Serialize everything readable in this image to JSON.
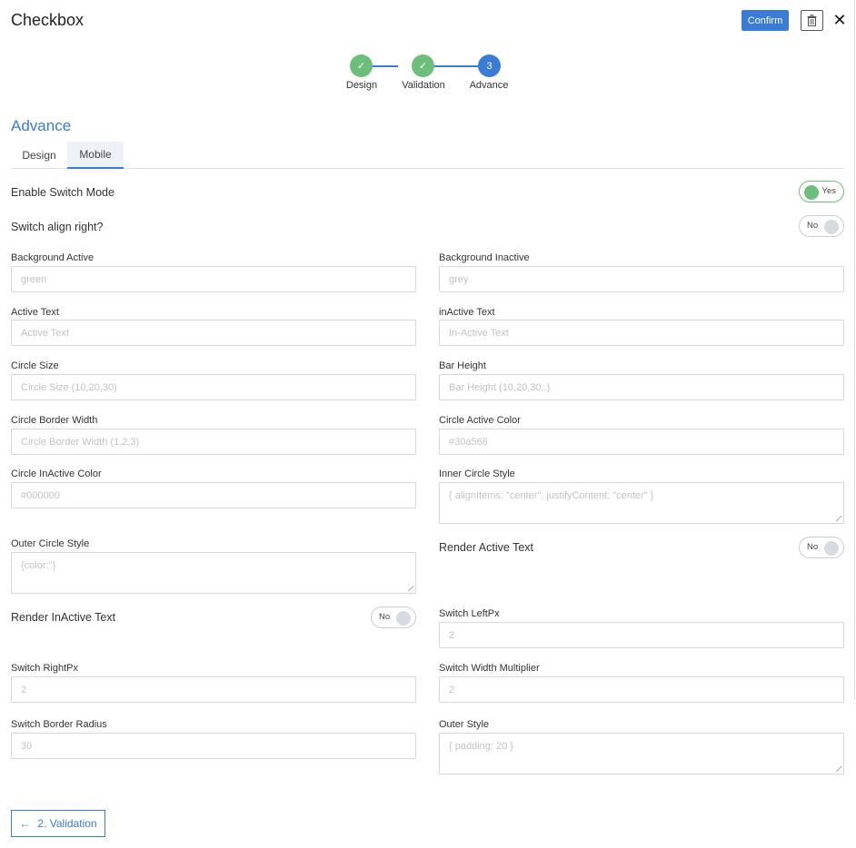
{
  "header": {
    "title": "Checkbox",
    "confirm_label": "Confirm",
    "trash_icon": "trash-icon",
    "close_glyph": "✕"
  },
  "stepper": {
    "steps": [
      {
        "label": "Design",
        "glyph": "✓",
        "state": "done"
      },
      {
        "label": "Validation",
        "glyph": "✓",
        "state": "done"
      },
      {
        "label": "Advance",
        "glyph": "3",
        "state": "active"
      }
    ]
  },
  "section": {
    "title": "Advance"
  },
  "tabs": [
    {
      "label": "Design",
      "active": false
    },
    {
      "label": "Mobile",
      "active": true
    }
  ],
  "switches": {
    "enable_switch_mode": {
      "label": "Enable Switch Mode",
      "value": "Yes"
    },
    "switch_align_right": {
      "label": "Switch align right?",
      "value": "No"
    },
    "render_active_text": {
      "label": "Render Active Text",
      "value": "No"
    },
    "render_inactive_text": {
      "label": "Render InActive Text",
      "value": "No"
    }
  },
  "fields": {
    "background_active": {
      "label": "Background Active",
      "placeholder": "green"
    },
    "background_inactive": {
      "label": "Background Inactive",
      "placeholder": "grey"
    },
    "active_text": {
      "label": "Active Text",
      "placeholder": "Active Text"
    },
    "inactive_text": {
      "label": "inActive Text",
      "placeholder": "In-Active Text"
    },
    "circle_size": {
      "label": "Circle Size",
      "placeholder": "Circle Size (10,20,30)"
    },
    "bar_height": {
      "label": "Bar Height",
      "placeholder": "Bar Height (10,20,30..)"
    },
    "circle_border_width": {
      "label": "Circle Border Width",
      "placeholder": "Circle Border Width (1,2,3)"
    },
    "circle_active_color": {
      "label": "Circle Active Color",
      "placeholder": "#30a566"
    },
    "circle_inactive_color": {
      "label": "Circle InActive Color",
      "placeholder": "#000000"
    },
    "inner_circle_style": {
      "label": "Inner Circle Style",
      "placeholder": "{ alignItems: \"center\", justifyContent: \"center\" }"
    },
    "outer_circle_style": {
      "label": "Outer Circle Style",
      "placeholder": "{color:''}"
    },
    "switch_left_px": {
      "label": "Switch LeftPx",
      "placeholder": "2"
    },
    "switch_right_px": {
      "label": "Switch RightPx",
      "placeholder": "2"
    },
    "switch_width_multiplier": {
      "label": "Switch Width Multiplier",
      "placeholder": "2"
    },
    "switch_border_radius": {
      "label": "Switch Border Radius",
      "placeholder": "30"
    },
    "outer_style": {
      "label": "Outer Style",
      "placeholder": "{ padding: 20 }"
    }
  },
  "footer": {
    "back_label": "2. Validation",
    "back_glyph": "←"
  },
  "colors": {
    "accent": "#3a7bd5",
    "success": "#6cbf7a"
  }
}
